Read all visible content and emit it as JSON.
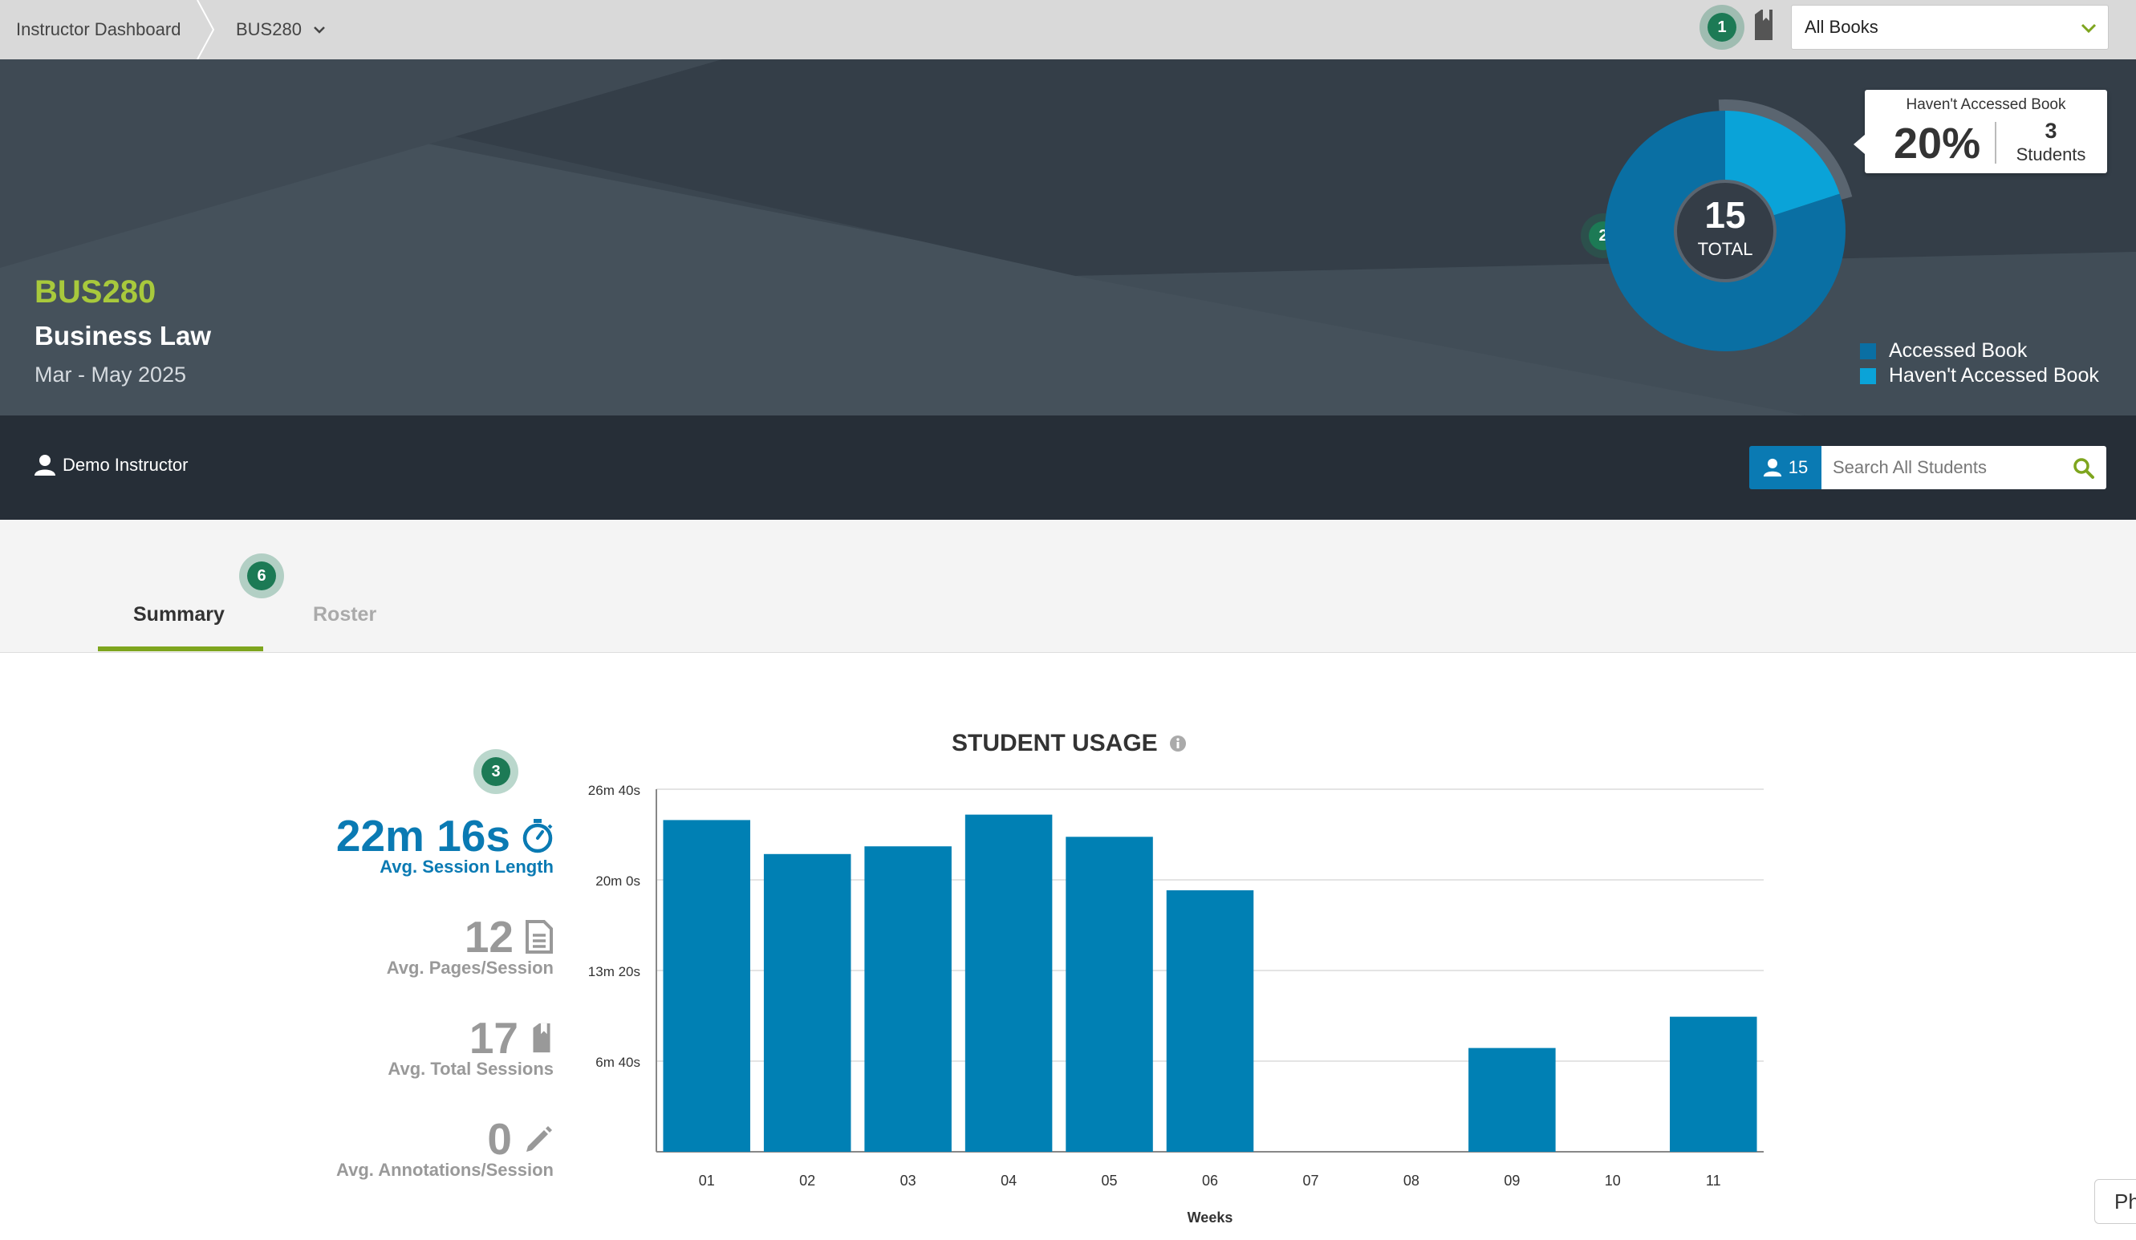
{
  "breadcrumb": {
    "dashboard": "Instructor Dashboard",
    "course": "BUS280"
  },
  "book_select": {
    "value": "All Books"
  },
  "badges": {
    "b1": "1",
    "b2": "2",
    "b3": "3",
    "b6": "6"
  },
  "course": {
    "code": "BUS280",
    "name": "Business Law",
    "dates": "Mar - May 2025"
  },
  "donut": {
    "total": "15",
    "total_label": "TOTAL",
    "accessed": 12,
    "not_accessed": 3,
    "colors": {
      "accessed": "#0a6fa3",
      "not_accessed": "#0aa3d8"
    }
  },
  "tooltip": {
    "title": "Haven't Accessed Book",
    "percent": "20%",
    "count": "3",
    "count_label": "Students"
  },
  "legend": [
    {
      "label": "Accessed Book",
      "color": "#0a6fa3"
    },
    {
      "label": "Haven't Accessed Book",
      "color": "#0aa3d8"
    }
  ],
  "instructor": {
    "name": "Demo Instructor"
  },
  "students": {
    "count": "15",
    "search_placeholder": "Search All Students"
  },
  "tabs": [
    {
      "label": "Summary",
      "active": true
    },
    {
      "label": "Roster",
      "active": false
    }
  ],
  "stats": [
    {
      "value": "22m 16s",
      "label": "Avg. Session Length",
      "icon": "stopwatch-icon"
    },
    {
      "value": "12",
      "label": "Avg. Pages/Session",
      "icon": "document-icon"
    },
    {
      "value": "17",
      "label": "Avg. Total Sessions",
      "icon": "book-icon"
    },
    {
      "value": "0",
      "label": "Avg. Annotations/Session",
      "icon": "pencil-icon"
    }
  ],
  "chart_data": {
    "type": "bar",
    "title": "STUDENT USAGE",
    "xlabel": "Weeks",
    "ylabel": "",
    "categories": [
      "01",
      "02",
      "03",
      "04",
      "05",
      "06",
      "07",
      "08",
      "09",
      "10",
      "11"
    ],
    "values_seconds": [
      1464,
      1314,
      1348,
      1488,
      1390,
      1154,
      0,
      0,
      458,
      0,
      596
    ],
    "y_ticks": [
      "6m 40s",
      "13m 20s",
      "20m 0s",
      "26m 40s"
    ],
    "y_tick_values_seconds": [
      400,
      800,
      1200,
      1600
    ],
    "ylim_seconds": [
      0,
      1600
    ],
    "grid": true,
    "color": "#0080b4"
  },
  "side_tab": {
    "label": "Ph"
  }
}
